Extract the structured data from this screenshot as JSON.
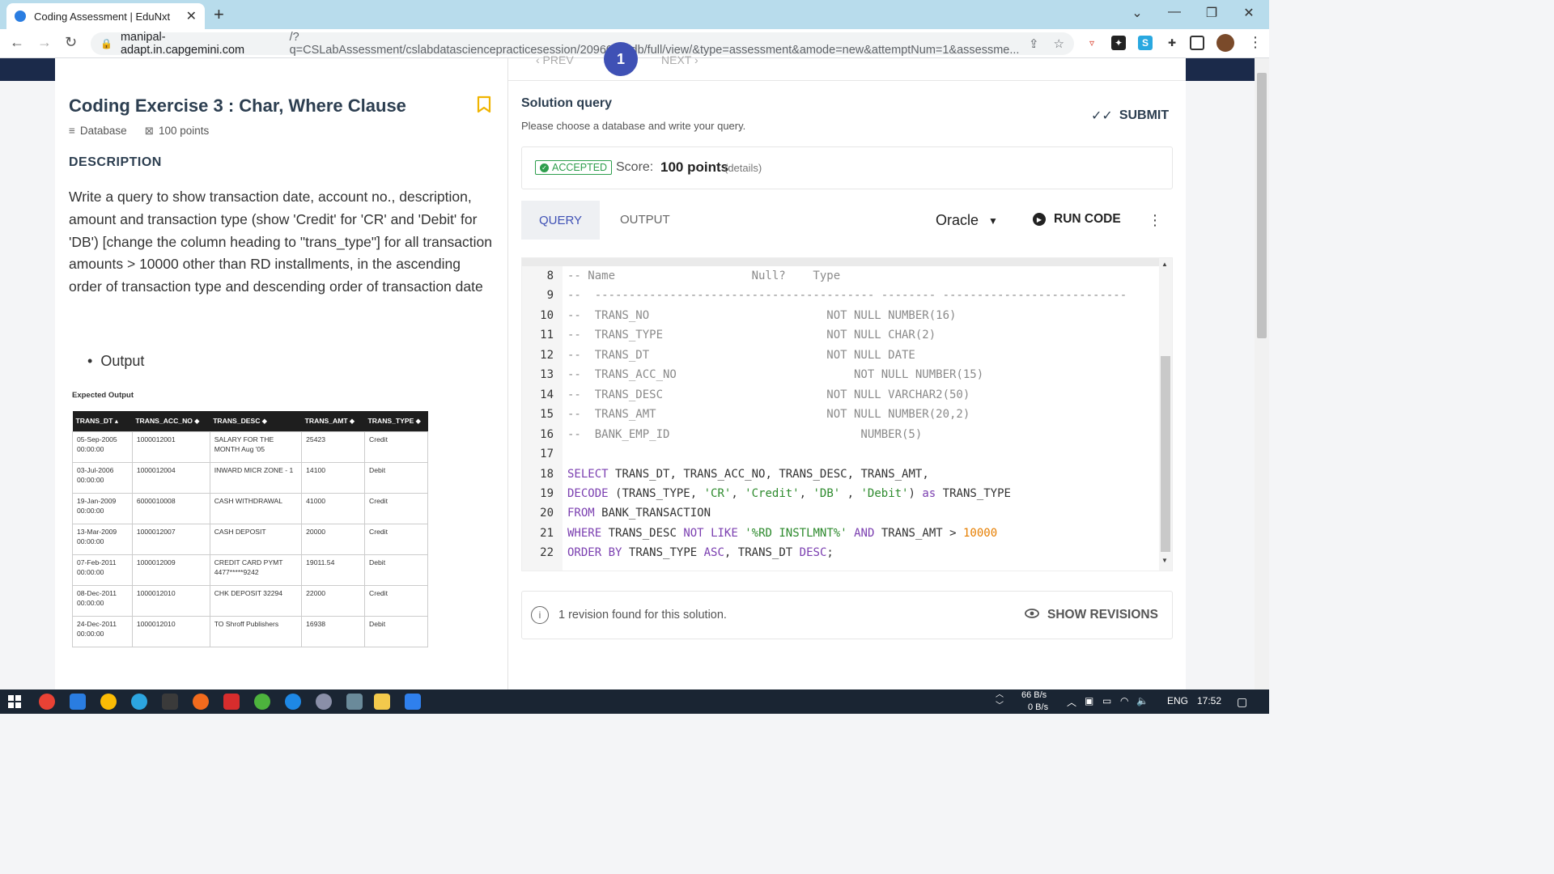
{
  "browser": {
    "tab_title": "Coding Assessment | EduNxt",
    "url_host": "manipal-adapt.in.capgemini.com",
    "url_path": "/?q=CSLabAssessment/cslabdatasciencepracticesession/209600/cidb/full/view/&type=assessment&amode=new&attemptNum=1&assessme..."
  },
  "pager": {
    "prev": "‹ PREV",
    "next": "NEXT ›",
    "current": "1"
  },
  "exercise": {
    "title": "Coding Exercise 3 : Char, Where Clause",
    "category": "Database",
    "points": "100 points",
    "description_heading": "DESCRIPTION",
    "description": "Write a query to show transaction date, account no., description, amount and transaction type (show 'Credit' for 'CR' and 'Debit' for 'DB') [change the column heading to \"trans_type\"] for all transaction amounts > 10000 other than RD installments, in the ascending order of transaction type and descending order of transaction date",
    "output_bullet": "Output",
    "expected_output_title": "Expected Output",
    "table": {
      "headers": [
        "TRANS_DT ▴",
        "TRANS_ACC_NO ⬥",
        "TRANS_DESC ⬥",
        "TRANS_AMT ⬥",
        "TRANS_TYPE ⬥"
      ],
      "rows": [
        [
          "05-Sep-2005 00:00:00",
          "1000012001",
          "SALARY FOR THE MONTH Aug '05",
          "25423",
          "Credit"
        ],
        [
          "03-Jul-2006 00:00:00",
          "1000012004",
          "INWARD MICR ZONE - 1",
          "14100",
          "Debit"
        ],
        [
          "19-Jan-2009 00:00:00",
          "6000010008",
          "CASH WITHDRAWAL",
          "41000",
          "Credit"
        ],
        [
          "13-Mar-2009 00:00:00",
          "1000012007",
          "CASH DEPOSIT",
          "20000",
          "Credit"
        ],
        [
          "07-Feb-2011 00:00:00",
          "1000012009",
          "CREDIT CARD PYMT 4477*****9242",
          "19011.54",
          "Debit"
        ],
        [
          "08-Dec-2011 00:00:00",
          "1000012010",
          "CHK DEPOSIT 32294",
          "22000",
          "Credit"
        ],
        [
          "24-Dec-2011 00:00:00",
          "1000012010",
          "TO Shroff Publishers",
          "16938",
          "Debit"
        ]
      ]
    }
  },
  "solution": {
    "title": "Solution query",
    "subtitle": "Please choose a database and write your query.",
    "submit_label": "SUBMIT",
    "accepted_label": "ACCEPTED",
    "score_label": "Score:",
    "score_value": "100 points",
    "details_label": "(details)",
    "tab_query": "QUERY",
    "tab_output": "OUTPUT",
    "language": "Oracle",
    "run_label": "RUN CODE",
    "revision_text": "1 revision found for this solution.",
    "show_revisions_label": "SHOW REVISIONS"
  },
  "editor": {
    "lines": [
      {
        "n": "8",
        "text": "-- Name                    Null?    Type"
      },
      {
        "n": "9",
        "text": "--  ----------------------------------------- -------- ---------------------------"
      },
      {
        "n": "10",
        "text": "--  TRANS_NO                          NOT NULL NUMBER(16)"
      },
      {
        "n": "11",
        "text": "--  TRANS_TYPE                        NOT NULL CHAR(2)"
      },
      {
        "n": "12",
        "text": "--  TRANS_DT                          NOT NULL DATE"
      },
      {
        "n": "13",
        "text": "--  TRANS_ACC_NO                          NOT NULL NUMBER(15)"
      },
      {
        "n": "14",
        "text": "--  TRANS_DESC                        NOT NULL VARCHAR2(50)"
      },
      {
        "n": "15",
        "text": "--  TRANS_AMT                         NOT NULL NUMBER(20,2)"
      },
      {
        "n": "16",
        "text": "--  BANK_EMP_ID                            NUMBER(5)"
      },
      {
        "n": "17",
        "text": ""
      },
      {
        "n": "18",
        "text": "SELECT TRANS_DT, TRANS_ACC_NO, TRANS_DESC, TRANS_AMT,"
      },
      {
        "n": "19",
        "text": "DECODE (TRANS_TYPE, 'CR', 'Credit', 'DB' , 'Debit') as TRANS_TYPE"
      },
      {
        "n": "20",
        "text": "FROM BANK_TRANSACTION"
      },
      {
        "n": "21",
        "text": "WHERE TRANS_DESC NOT LIKE '%RD INSTLMNT%' AND TRANS_AMT > 10000"
      },
      {
        "n": "22",
        "text": "ORDER BY TRANS_TYPE ASC, TRANS_DT DESC;"
      }
    ]
  },
  "taskbar": {
    "net_up": "66 B/s",
    "net_down": "0 B/s",
    "lang": "ENG",
    "time": "17:52"
  },
  "colors": {
    "accent": "#3f51b5",
    "accepted": "#2e9e4d",
    "navy": "#1b2a4a",
    "bookmark": "#f0b400"
  }
}
